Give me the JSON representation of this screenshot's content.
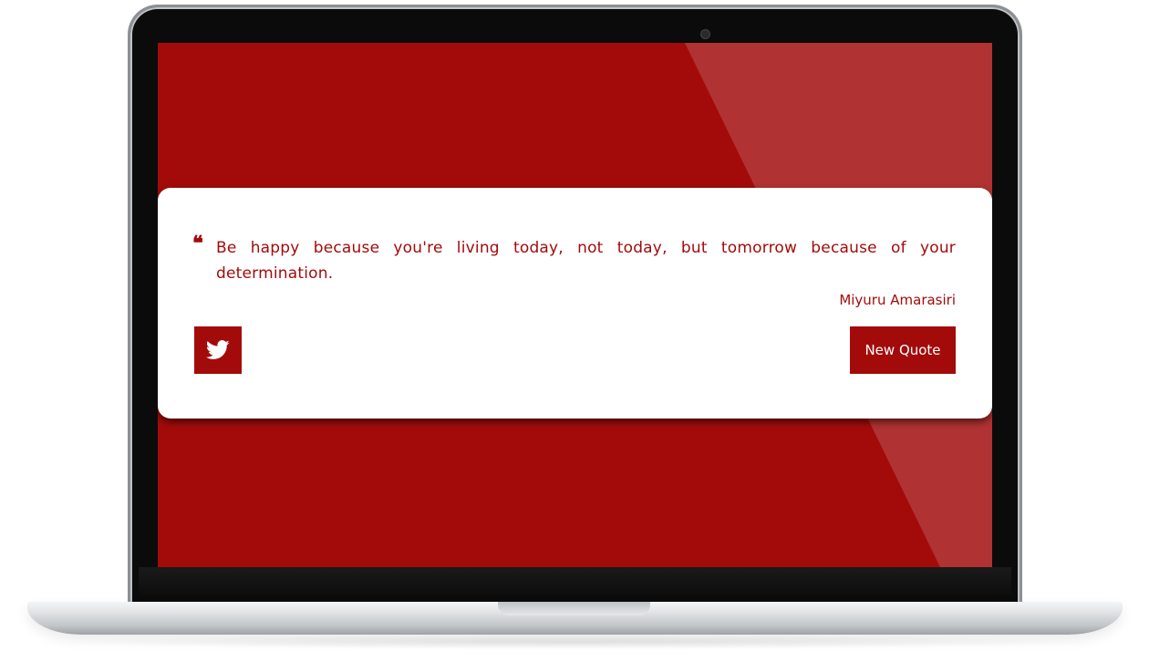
{
  "quote": {
    "mark": "❝",
    "text": "Be happy because you're living today, not today, but tomorrow because of your determination.",
    "author": "Miyuru Amarasiri"
  },
  "actions": {
    "tweet_icon": "twitter-icon",
    "new_quote_label": "New Quote"
  },
  "colors": {
    "accent": "#a30b0b",
    "card": "#ffffff"
  }
}
